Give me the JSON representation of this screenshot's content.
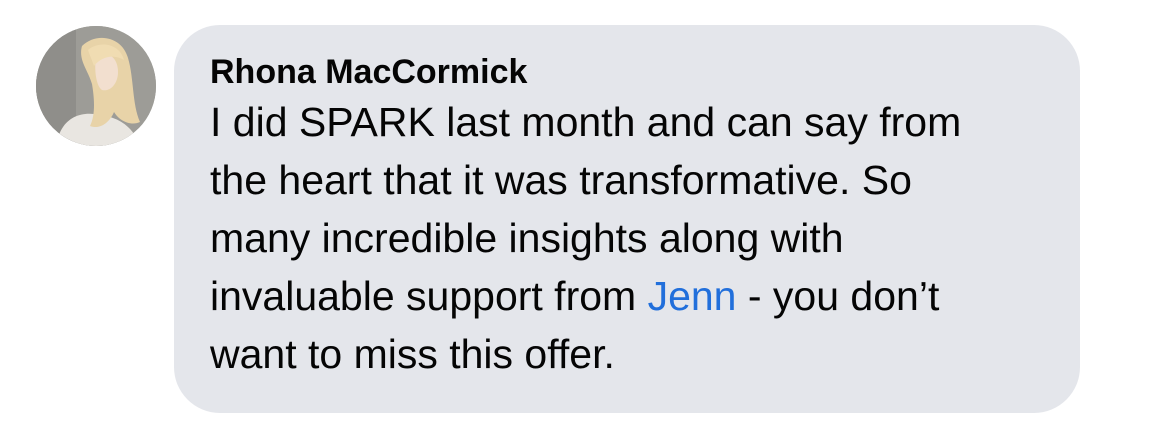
{
  "comment": {
    "author": "Rhona MacCormick",
    "avatar_icon": "profile-photo-avatar",
    "lines": [
      "I did SPARK last month and can say from",
      "the heart that it was transformative. So",
      "many incredible insights along with"
    ],
    "line4_before": "invaluable support from ",
    "mention": "Jenn",
    "line4_after": " - you don’t",
    "line5": "want to miss this offer."
  },
  "colors": {
    "bubble_background": "#e4e6eb",
    "text": "#050505",
    "mention_link": "#216fdb"
  }
}
